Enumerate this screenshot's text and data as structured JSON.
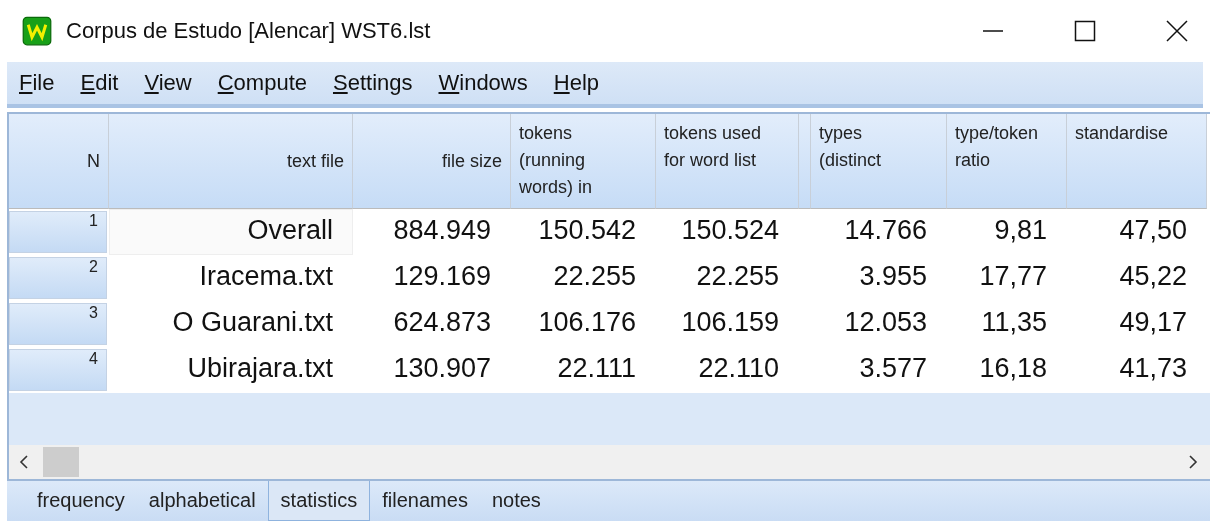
{
  "window": {
    "title": "Corpus de Estudo [Alencar] WST6.lst"
  },
  "menu": [
    {
      "label": "File"
    },
    {
      "label": "Edit"
    },
    {
      "label": "View"
    },
    {
      "label": "Compute"
    },
    {
      "label": "Settings"
    },
    {
      "label": "Windows"
    },
    {
      "label": "Help"
    }
  ],
  "table": {
    "columns": [
      {
        "lines": [
          "N"
        ]
      },
      {
        "lines": [
          "text file"
        ]
      },
      {
        "lines": [
          "file size"
        ]
      },
      {
        "lines": [
          "tokens",
          "(running",
          "words) in"
        ]
      },
      {
        "lines": [
          "tokens used",
          "for word list"
        ]
      },
      {
        "lines": [
          "types",
          "(distinct"
        ]
      },
      {
        "lines": [
          "type/token",
          "ratio"
        ]
      },
      {
        "lines": [
          "standardise"
        ]
      }
    ],
    "rows": [
      {
        "focused": true,
        "cells": [
          "1",
          "Overall",
          "884.949",
          "150.542",
          "150.524",
          "14.766",
          "9,81",
          "47,50"
        ]
      },
      {
        "focused": false,
        "cells": [
          "2",
          "Iracema.txt",
          "129.169",
          "22.255",
          "22.255",
          "3.955",
          "17,77",
          "45,22"
        ]
      },
      {
        "focused": false,
        "cells": [
          "3",
          "O Guarani.txt",
          "624.873",
          "106.176",
          "106.159",
          "12.053",
          "11,35",
          "49,17"
        ]
      },
      {
        "focused": false,
        "cells": [
          "4",
          "Ubirajara.txt",
          "130.907",
          "22.111",
          "22.110",
          "3.577",
          "16,18",
          "41,73"
        ]
      }
    ]
  },
  "tabs": [
    {
      "label": "frequency",
      "selected": false
    },
    {
      "label": "alphabetical",
      "selected": false
    },
    {
      "label": "statistics",
      "selected": true
    },
    {
      "label": "filenames",
      "selected": false
    },
    {
      "label": "notes",
      "selected": false
    }
  ]
}
